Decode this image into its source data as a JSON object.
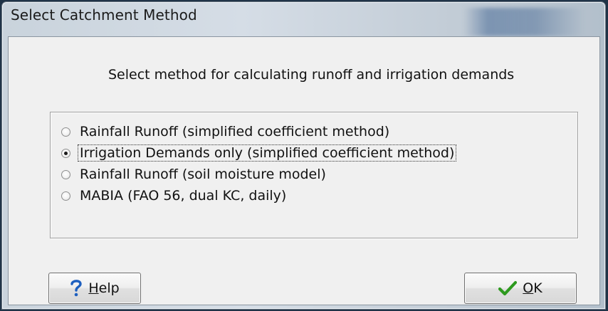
{
  "window": {
    "title": "Select Catchment Method"
  },
  "dialog": {
    "heading": "Select method for calculating runoff and irrigation demands",
    "options": [
      {
        "label": "Rainfall Runoff (simplified coefficient method)",
        "checked": false,
        "focused": false
      },
      {
        "label": "Irrigation Demands only (simplified coefficient method)",
        "checked": true,
        "focused": true
      },
      {
        "label": "Rainfall Runoff (soil moisture model)",
        "checked": false,
        "focused": false
      },
      {
        "label": "MABIA (FAO 56, dual KC, daily)",
        "checked": false,
        "focused": false
      }
    ]
  },
  "buttons": {
    "help": {
      "accel": "H",
      "rest": "elp",
      "icon": "question-icon",
      "icon_color": "#1d5fbf"
    },
    "ok": {
      "accel": "O",
      "rest": "K",
      "icon": "checkmark-icon",
      "icon_color": "#2e9a1f"
    }
  }
}
